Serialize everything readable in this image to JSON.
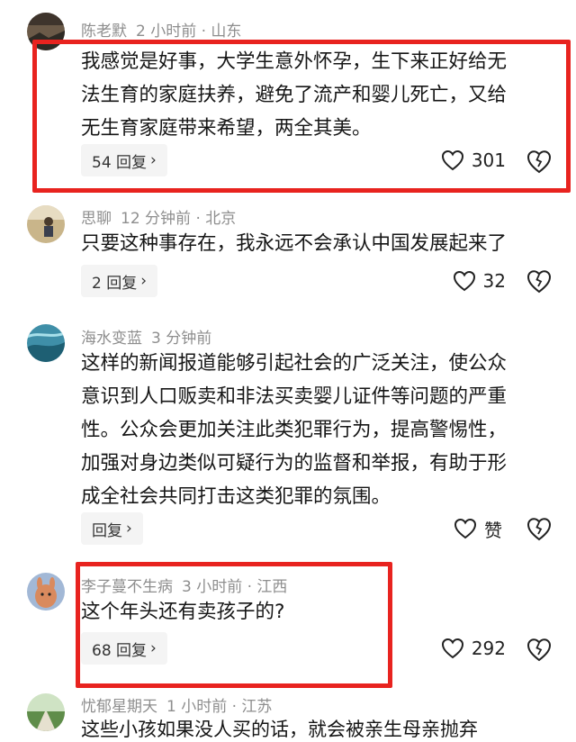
{
  "comments": [
    {
      "user": "陈老默",
      "time": "2 小时前 · 山东",
      "text": "我感觉是好事，大学生意外怀孕，生下来正好给无\n法生育的家庭扶养，避免了流产和婴儿死亡，又给\n无生育家庭带来希望，两全其美。",
      "reply_label": "54 回复",
      "likes": "301"
    },
    {
      "user": "思聊",
      "time": "12 分钟前 · 北京",
      "text": "只要这种事存在，我永远不会承认中国发展起来了",
      "reply_label": "2 回复",
      "likes": "32"
    },
    {
      "user": "海水变蓝",
      "time": "3 分钟前",
      "text": "这样的新闻报道能够引起社会的广泛关注，使公众\n意识到人口贩卖和非法买卖婴儿证件等问题的严重\n性。公众会更加关注此类犯罪行为，提高警惕性，\n加强对身边类似可疑行为的监督和举报，有助于形\n成全社会共同打击这类犯罪的氛围。",
      "reply_label": "回复",
      "likes": "赞"
    },
    {
      "user": "李子蔓不生病",
      "time": "3 小时前 · 江西",
      "text": "这个年头还有卖孩子的?",
      "reply_label": "68 回复",
      "likes": "292"
    },
    {
      "user": "忧郁星期天",
      "time": "1 小时前 · 江苏",
      "text": "这些小孩如果没人买的话，就会被亲生母亲抛弃"
    }
  ],
  "icons": {
    "like": "heart-outline-icon",
    "dislike": "broken-heart-icon",
    "reply_chevron": "chevron-right-icon"
  },
  "colors": {
    "highlight_box": "#e8231f",
    "meta_text": "#8e8e8e",
    "reply_bg": "#f4f4f4"
  }
}
